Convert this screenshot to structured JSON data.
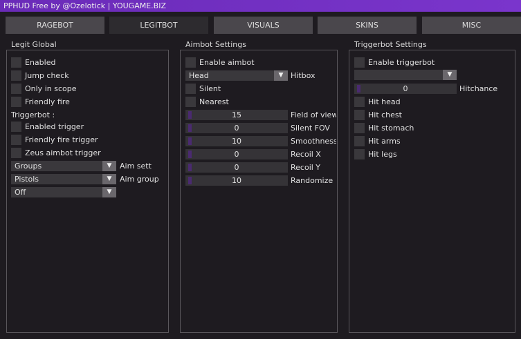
{
  "title": "PPHUD Free by @Ozelotick | YOUGAME.BIZ",
  "tabs": [
    "RAGEBOT",
    "LEGITBOT",
    "VISUALS",
    "SKINS",
    "MISC"
  ],
  "legit_global": {
    "title": "Legit Global",
    "checks": [
      "Enabled",
      "Jump check",
      "Only in scope",
      "Friendly fire"
    ],
    "triggerbot_label": "Triggerbot :",
    "trigger_checks": [
      "Enabled trigger",
      "Friendly fire trigger",
      "Zeus aimbot trigger"
    ],
    "dropdowns": [
      {
        "value": "Groups",
        "label": "Aim sett"
      },
      {
        "value": "Pistols",
        "label": "Aim group"
      },
      {
        "value": "Off",
        "label": ""
      }
    ]
  },
  "aimbot": {
    "title": "Aimbot Settings",
    "enable": "Enable aimbot",
    "hitbox": {
      "value": "Head",
      "label": "Hitbox"
    },
    "checks": [
      "Silent",
      "Nearest"
    ],
    "sliders": [
      {
        "value": "15",
        "label": "Field of view"
      },
      {
        "value": "0",
        "label": "Silent FOV"
      },
      {
        "value": "10",
        "label": "Smoothness"
      },
      {
        "value": "0",
        "label": "Recoil X"
      },
      {
        "value": "0",
        "label": "Recoil Y"
      },
      {
        "value": "10",
        "label": "Randomize"
      }
    ]
  },
  "trigger": {
    "title": "Triggerbot Settings",
    "enable": "Enable triggerbot",
    "hitchance": {
      "value": "0",
      "label": "Hitchance"
    },
    "checks": [
      "Hit head",
      "Hit chest",
      "Hit stomach",
      "Hit arms",
      "Hit legs"
    ]
  },
  "arrow": "▼"
}
